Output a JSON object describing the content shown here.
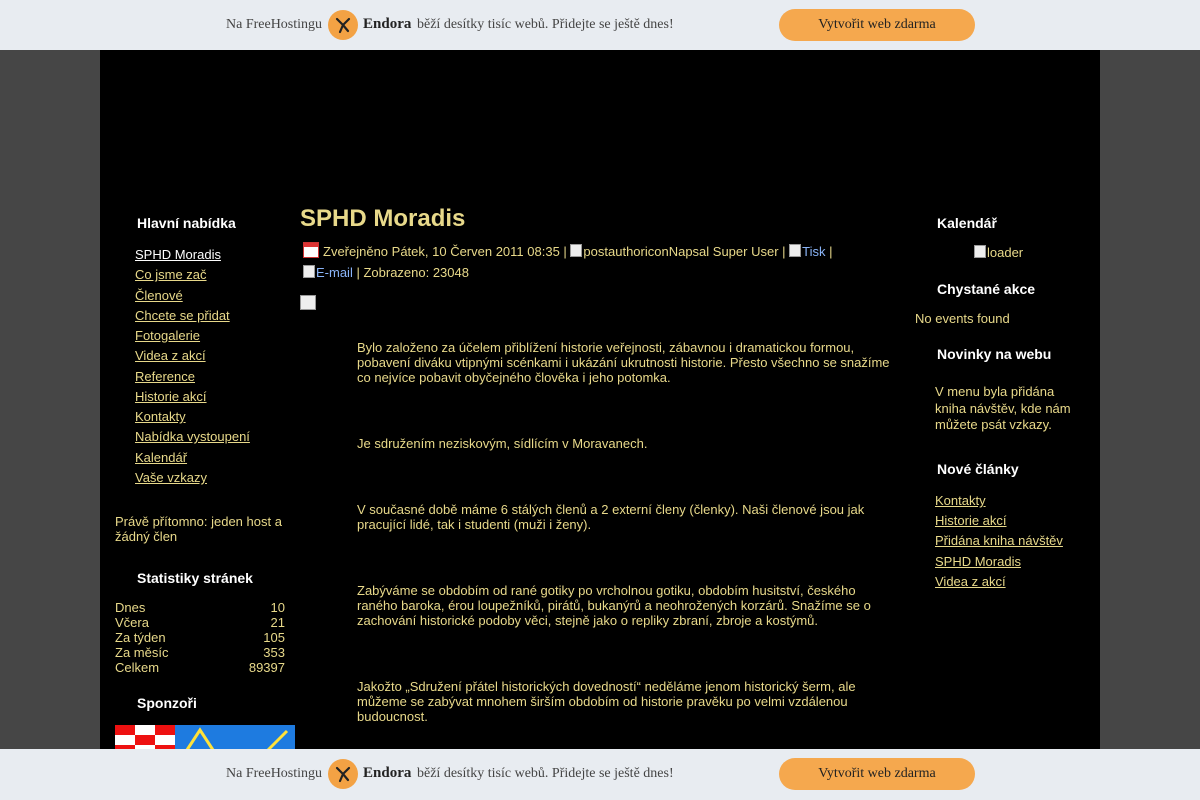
{
  "banner": {
    "text_before": "Na FreeHostingu",
    "brand": "Endora",
    "text_after": "běží desítky tisíc webů. Přidejte se ještě dnes!",
    "button": "Vytvořit web zdarma",
    "logo_color": "#f3a244",
    "button_color": "#f5a84e"
  },
  "left": {
    "menu_title": "Hlavní nabídka",
    "menu": [
      {
        "label": "SPHD Moradis"
      },
      {
        "label": "Co jsme zač"
      },
      {
        "label": "Členové"
      },
      {
        "label": "Chcete se přidat"
      },
      {
        "label": "Fotogalerie"
      },
      {
        "label": "Videa z akcí"
      },
      {
        "label": "Reference"
      },
      {
        "label": "Historie akcí"
      },
      {
        "label": "Kontakty"
      },
      {
        "label": "Nabídka vystoupení"
      },
      {
        "label": "Kalendář"
      },
      {
        "label": "Vaše vzkazy"
      }
    ],
    "present": "Právě přítomno: jeden host a žádný člen",
    "stats_title": "Statistiky stránek",
    "stats": [
      {
        "label": "Dnes",
        "value": "10"
      },
      {
        "label": "Včera",
        "value": "21"
      },
      {
        "label": "Za týden",
        "value": "105"
      },
      {
        "label": "Za měsíc",
        "value": "353"
      },
      {
        "label": "Celkem",
        "value": "89397"
      }
    ],
    "sponsors_title": "Sponzoři"
  },
  "article": {
    "title": "SPHD Moradis",
    "published": "Zveřejněno Pátek, 10 Červen 2011 08:35 |",
    "author_icon_alt": "postauthoricon",
    "author": "Napsal Super User |",
    "print_alt": "Tisk",
    "sep": "|",
    "email_alt": "E-mail",
    "views": "| Zobrazeno: 23048",
    "paragraphs": [
      "Bylo založeno za účelem přiblížení historie veřejnosti, zábavnou i dramatickou formou, pobavení diváku vtipnými scénkami i ukázání ukrutnosti historie. Přesto všechno se snažíme co nejvíce pobavit obyčejného člověka i jeho potomka.",
      "Je sdružením neziskovým, sídlícím v Moravanech.",
      "V současné době máme 6 stálých členů a 2 externí členy (členky). Naši členové jsou jak pracující lidé, tak i studenti (muži i ženy).",
      "Zabýváme se obdobím od rané gotiky po vrcholnou gotiku, obdobím husitství, českého raného baroka, érou loupežníků, pirátů, bukanýrů a neohrožených korzárů. Snažíme se o zachování historické podoby věci, stejně jako o repliky zbraní, zbroje a kostýmů.",
      "Jakožto „Sdružení přátel historických dovedností“ neděláme jenom historický šerm, ale můžeme se zabývat mnohem širším obdobím od historie pravěku po velmi vzdálenou budoucnost."
    ]
  },
  "right": {
    "calendar_title": "Kalendář",
    "loader_alt": "loader",
    "events_title": "Chystané akce",
    "no_events": "No events found",
    "news_title": "Novinky na webu",
    "news_text": "V menu byla přidána kniha návštěv, kde nám můžete psát vzkazy.",
    "articles_title": "Nové články",
    "articles": [
      {
        "label": "Kontakty"
      },
      {
        "label": "Historie akcí"
      },
      {
        "label": "Přidána kniha návštěv"
      },
      {
        "label": "SPHD Moradis"
      },
      {
        "label": "Videa z akcí"
      }
    ]
  }
}
